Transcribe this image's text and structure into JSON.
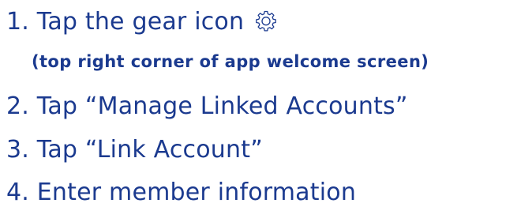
{
  "colors": {
    "text": "#1b3a8f",
    "background": "#ffffff"
  },
  "steps": [
    {
      "label": "1. Tap the gear icon",
      "icon": "gear-icon",
      "note": "(top right corner of app welcome screen)"
    },
    {
      "label": "2. Tap “Manage Linked Accounts”"
    },
    {
      "label": "3. Tap “Link Account”"
    },
    {
      "label": "4. Enter member information"
    }
  ]
}
